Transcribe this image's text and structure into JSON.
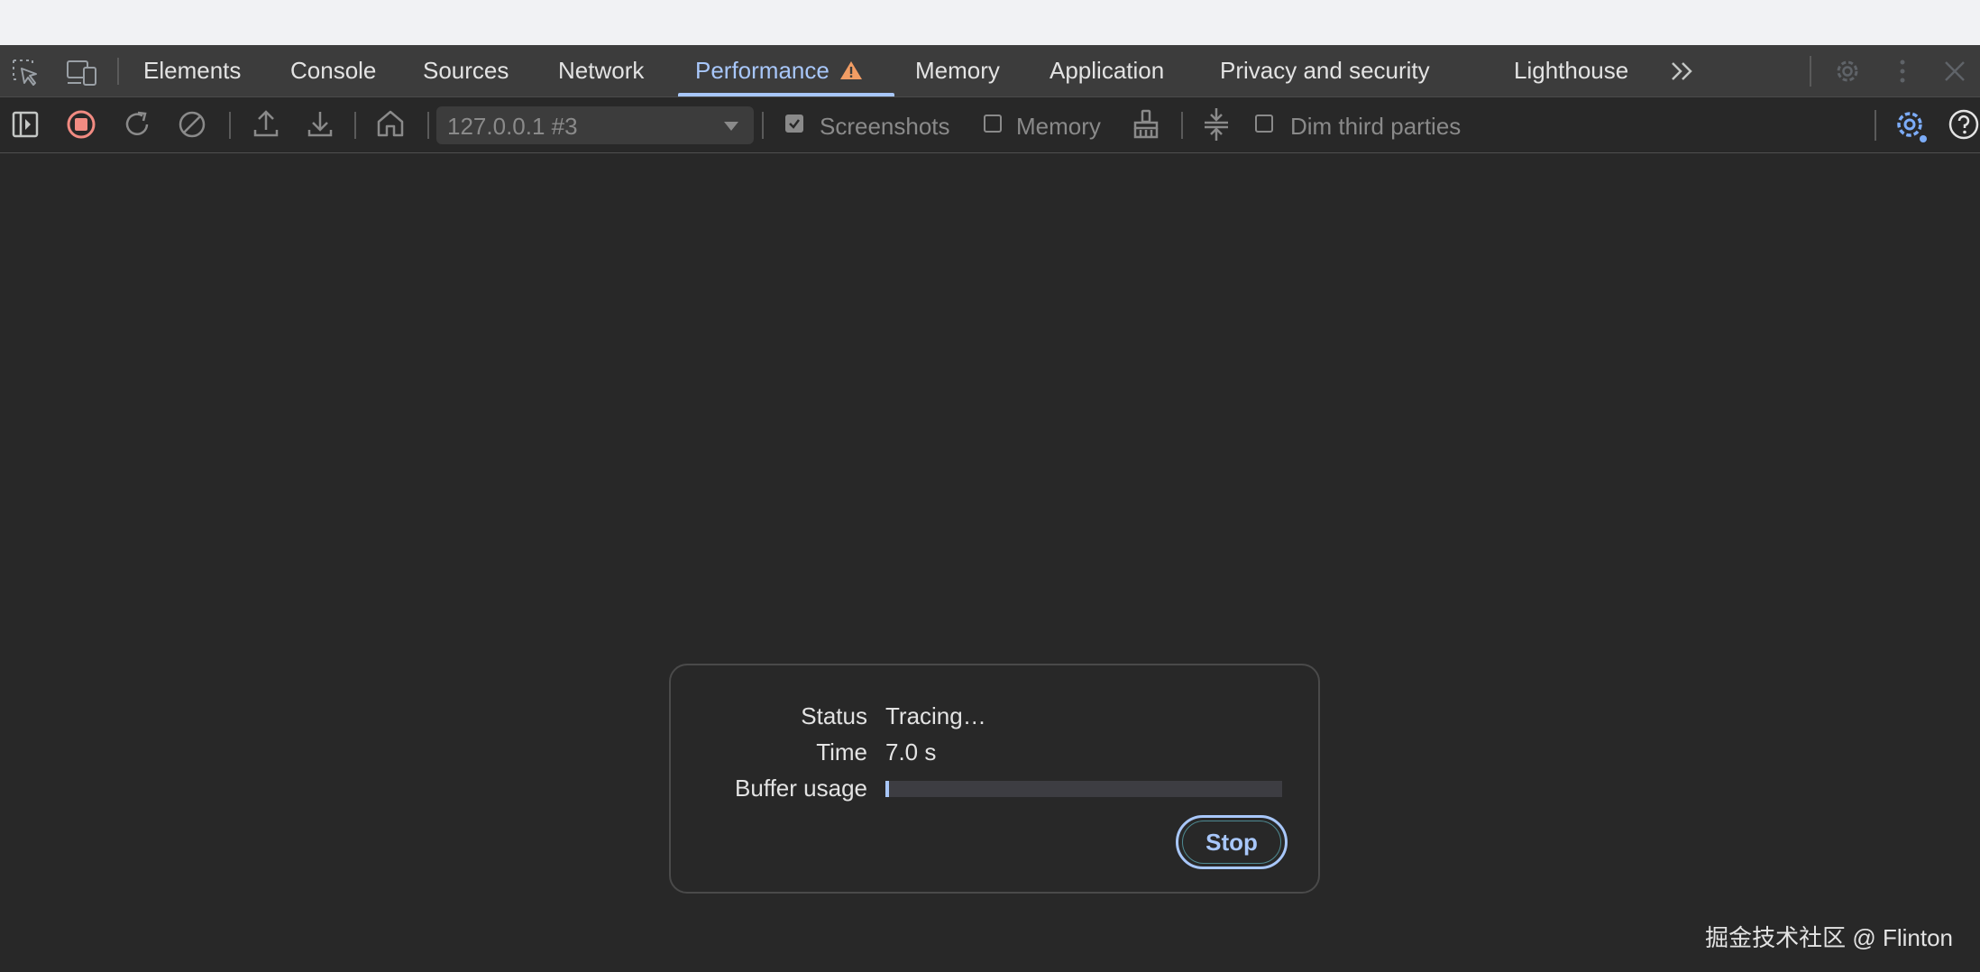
{
  "tabs": [
    {
      "label": "Elements"
    },
    {
      "label": "Console"
    },
    {
      "label": "Sources"
    },
    {
      "label": "Network"
    },
    {
      "label": "Performance",
      "active": true
    },
    {
      "label": "Memory"
    },
    {
      "label": "Application"
    },
    {
      "label": "Privacy and security"
    },
    {
      "label": "Lighthouse"
    }
  ],
  "toolbar": {
    "target": "127.0.0.1 #3",
    "screenshots_label": "Screenshots",
    "screenshots_checked": true,
    "memory_label": "Memory",
    "memory_checked": false,
    "dim_third_parties_label": "Dim third parties",
    "dim_third_parties_checked": false
  },
  "recording": {
    "status_label": "Status",
    "status_value": "Tracing…",
    "time_label": "Time",
    "time_value": "7.0 s",
    "buffer_label": "Buffer usage",
    "buffer_usage": 0.01,
    "stop_label": "Stop"
  },
  "watermark": "掘金技术社区 @ Flinton",
  "colors": {
    "accent": "#a8c7fa",
    "record": "#f28b82",
    "warning": "#f29d64",
    "background": "#282828",
    "tabbar": "#3c3c3c"
  },
  "icons": [
    "inspect-element-icon",
    "device-toggle-icon",
    "warning-icon",
    "more-tabs-icon",
    "settings-icon",
    "more-options-icon",
    "close-icon",
    "toggle-sidebar-icon",
    "record-stop-icon",
    "reload-record-icon",
    "clear-icon",
    "upload-icon",
    "download-icon",
    "home-icon",
    "dropdown-caret-icon",
    "garbage-collect-icon",
    "collapse-track-icon",
    "capture-settings-icon",
    "help-icon"
  ]
}
